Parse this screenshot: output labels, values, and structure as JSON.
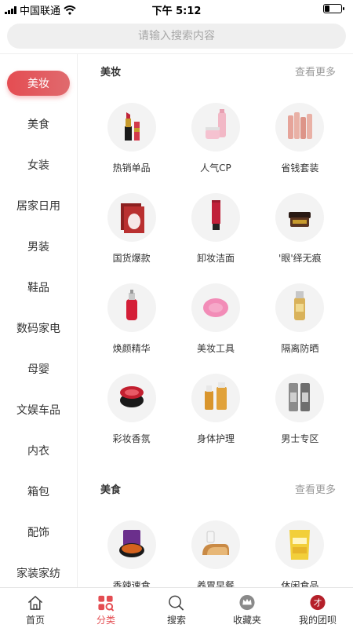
{
  "status_bar": {
    "carrier": "中国联通",
    "time": "下午 5:12",
    "battery_level": 0.3
  },
  "search": {
    "placeholder": "请输入搜索内容"
  },
  "sidebar": {
    "active_index": 0,
    "items": [
      {
        "label": "美妆"
      },
      {
        "label": "美食"
      },
      {
        "label": "女装"
      },
      {
        "label": "居家日用"
      },
      {
        "label": "男装"
      },
      {
        "label": "鞋品"
      },
      {
        "label": "数码家电"
      },
      {
        "label": "母婴"
      },
      {
        "label": "文娱车品"
      },
      {
        "label": "内衣"
      },
      {
        "label": "箱包"
      },
      {
        "label": "配饰"
      },
      {
        "label": "家装家纺"
      }
    ]
  },
  "sections": [
    {
      "title": "美妆",
      "more": "查看更多",
      "items": [
        {
          "label": "热销单品",
          "icon": "lipstick-icon"
        },
        {
          "label": "人气CP",
          "icon": "cosmetics-set-icon"
        },
        {
          "label": "省钱套装",
          "icon": "bottles-set-icon"
        },
        {
          "label": "国货爆款",
          "icon": "face-mask-icon"
        },
        {
          "label": "卸妆洁面",
          "icon": "cleanser-tube-icon"
        },
        {
          "label": "'眼'绎无痕",
          "icon": "eye-cream-jar-icon"
        },
        {
          "label": "焕颜精华",
          "icon": "serum-bottle-icon"
        },
        {
          "label": "美妆工具",
          "icon": "cleansing-brush-icon"
        },
        {
          "label": "隔离防晒",
          "icon": "sunscreen-icon"
        },
        {
          "label": "彩妆香氛",
          "icon": "cushion-compact-icon"
        },
        {
          "label": "身体护理",
          "icon": "body-oil-icon"
        },
        {
          "label": "男士专区",
          "icon": "men-care-icon"
        }
      ]
    },
    {
      "title": "美食",
      "more": "查看更多",
      "items": [
        {
          "label": "香辣速食",
          "icon": "spicy-food-icon"
        },
        {
          "label": "养胃早餐",
          "icon": "bread-milk-icon"
        },
        {
          "label": "休闲食品",
          "icon": "chips-bag-icon"
        }
      ]
    }
  ],
  "tabbar": {
    "active_index": 1,
    "items": [
      {
        "label": "首页",
        "icon": "home-icon"
      },
      {
        "label": "分类",
        "icon": "category-icon"
      },
      {
        "label": "搜索",
        "icon": "search-icon"
      },
      {
        "label": "收藏夹",
        "icon": "favorites-crown-icon"
      },
      {
        "label": "我的团呗",
        "icon": "profile-icon"
      }
    ]
  },
  "colors": {
    "accent": "#e44d52",
    "text": "#333333",
    "muted": "#999999"
  }
}
